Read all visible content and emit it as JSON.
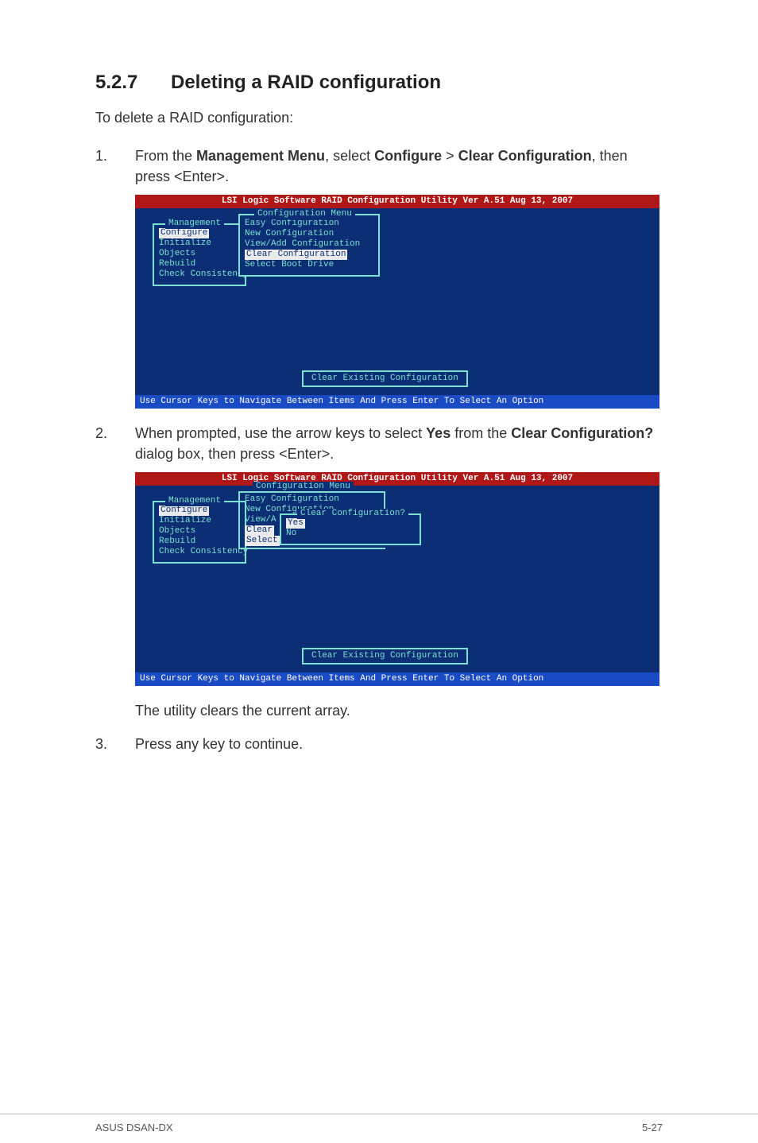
{
  "section": {
    "number": "5.2.7",
    "title": "Deleting a RAID configuration"
  },
  "intro": "To delete a RAID configuration:",
  "steps": [
    {
      "num": "1.",
      "pre": "From the ",
      "b1": "Management Menu",
      "mid1": ", select ",
      "b2": "Configure",
      "mid2": " > ",
      "b3": "Clear Configuration",
      "post": ", then press <Enter>."
    },
    {
      "num": "2.",
      "pre": "When prompted, use the arrow keys to select ",
      "b1": "Yes",
      "mid1": " from the ",
      "b2": "Clear Configuration?",
      "post": " dialog box, then press <Enter>."
    },
    {
      "num": "",
      "plain": "The utility clears the current array."
    },
    {
      "num": "3.",
      "plain": "Press any key to continue."
    }
  ],
  "terminal": {
    "header": "LSI Logic Software RAID Configuration Utility Ver A.51 Aug 13, 2007",
    "footer": "Use Cursor Keys to Navigate Between Items And Press Enter To Select An Option",
    "hint": "Clear Existing Configuration",
    "mgmt": {
      "legend": "Management",
      "items": [
        "Configure",
        "Initialize",
        "Objects",
        "Rebuild",
        "Check Consistency"
      ]
    },
    "conf": {
      "legend": "Configuration Menu",
      "items": [
        "Easy Configuration",
        "New Configuration",
        "View/Add Configuration",
        "Clear Configuration",
        "Select Boot Drive"
      ]
    },
    "conf_trunc": {
      "line1": "Easy Configuration",
      "line2": "New Configuration",
      "line3a": "View/A",
      "line3b_stub": "Clear",
      "line4b_stub": "Select"
    },
    "clearq": {
      "legend": "Clear Configuration?",
      "items": [
        "Yes",
        "No"
      ]
    }
  },
  "footer": {
    "left": "ASUS DSAN-DX",
    "right": "5-27"
  }
}
